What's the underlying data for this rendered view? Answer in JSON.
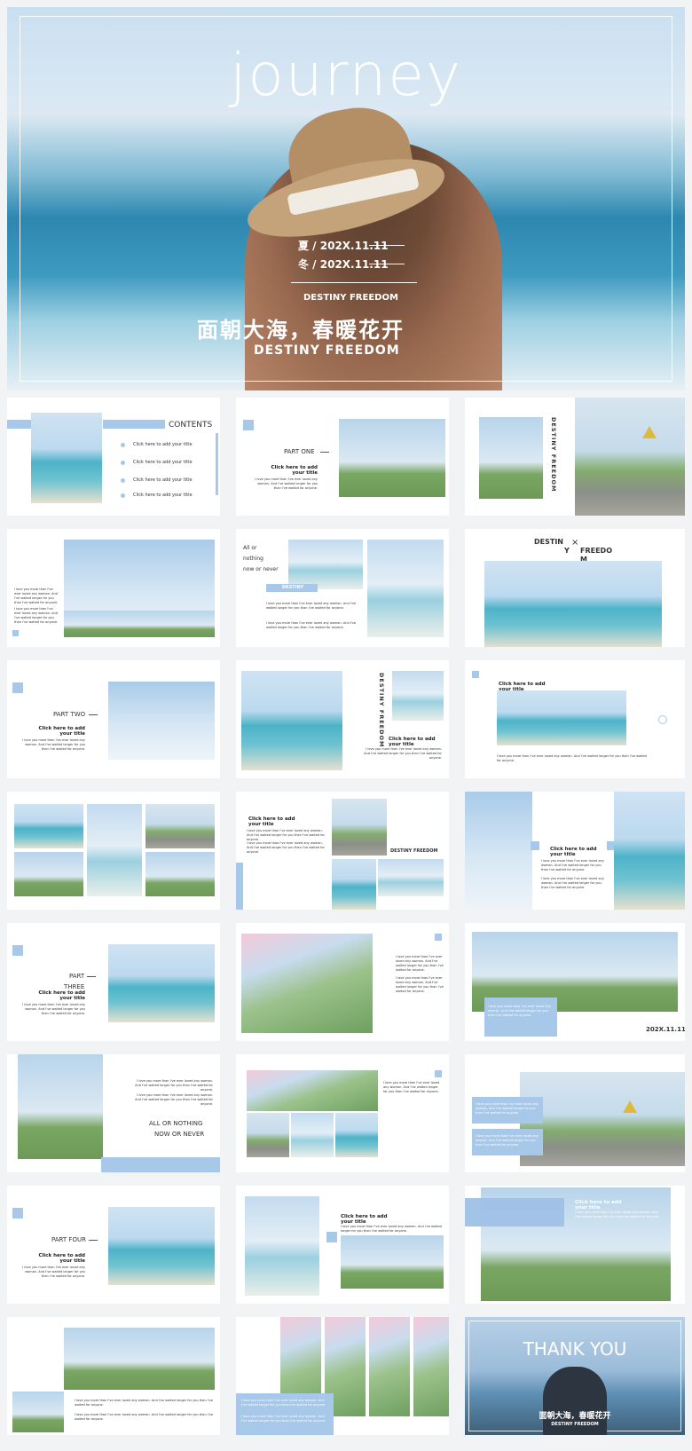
{
  "hero": {
    "title": "journey",
    "dates": [
      "夏 / 202X.11.11",
      "冬 / 202X.11.11"
    ],
    "subtitle": "DESTINY  FREEDOM",
    "cn_title": "面朝大海，春暖花开",
    "en_title": "DESTINY  FREEDOM"
  },
  "contents": {
    "heading": "CONTENTS",
    "items": [
      "Click here to add your title",
      "Click here to add your title",
      "Click here to add your title",
      "Click here to add your title"
    ]
  },
  "parts": {
    "one": "PART ONE",
    "two": "PART TWO",
    "three_a": "PART",
    "three_b": "THREE",
    "four": "PART FOUR"
  },
  "common": {
    "click_title": "Click here to add your title",
    "body": "I love you more than I've ever loved any woman. And I've waited longer for you than I've waited for anyone.",
    "destiny_freedom": "DESTINY  FREEDOM",
    "destiny_badge": "DESTINY",
    "date": "202X.11.11"
  },
  "s3": {
    "vertical": "DESTINY  FREEDOM"
  },
  "s5": {
    "line1": "All or",
    "line2": "nothing",
    "line3": "now or never"
  },
  "s6": {
    "left": "DESTIN",
    "x": "×",
    "right": "FREEDO",
    "left2": "Y",
    "right2": "M"
  },
  "s17": {
    "line1": "ALL OR NOTHING",
    "line2": "NOW OR NEVER"
  },
  "thankyou": {
    "title": "THANK YOU",
    "cn": "面朝大海，春暖花开",
    "en": "DESTINY  FREEDOM"
  }
}
